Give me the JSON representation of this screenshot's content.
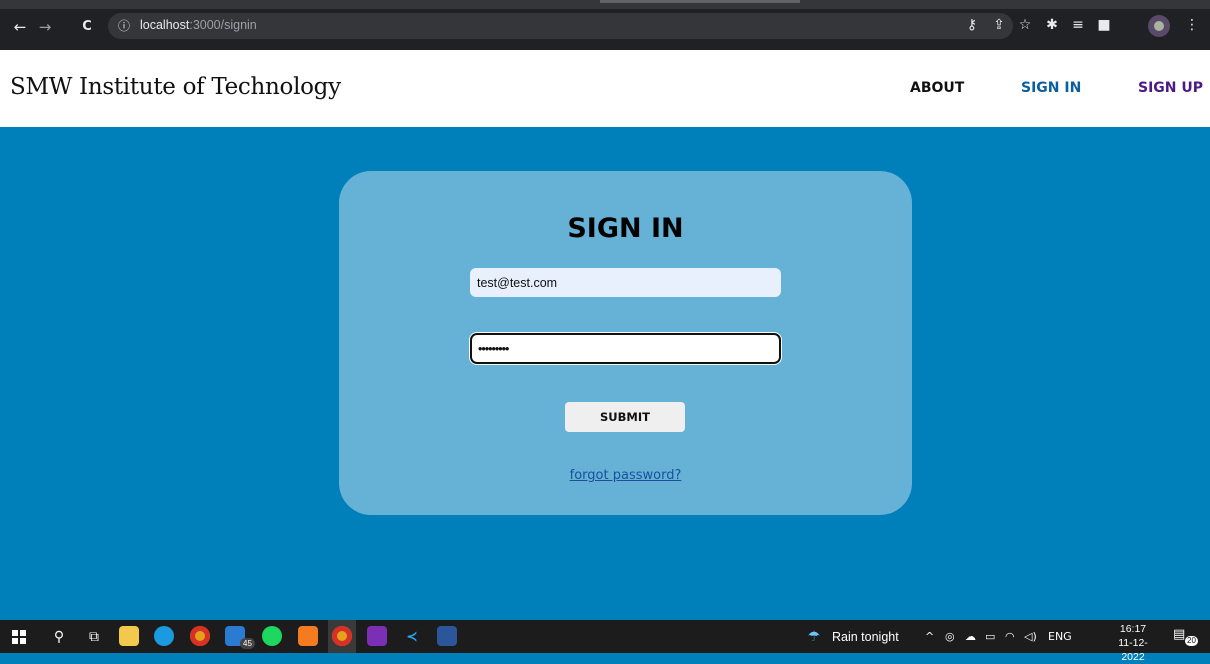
{
  "browser": {
    "back_glyph": "←",
    "forward_glyph": "→",
    "reload_glyph": "C",
    "url_host": "localhost",
    "url_rest": ":3000/signin",
    "info_glyph": "ⓘ",
    "icons": [
      "key-icon",
      "share-icon",
      "star-icon",
      "extensions-icon",
      "reading-list-icon",
      "side-panel-icon",
      "profile-icon",
      "menu-icon"
    ]
  },
  "header": {
    "brand": "SMW Institute of Technology",
    "nav": {
      "about": "ABOUT",
      "signin": "SIGN IN",
      "signup": "SIGN UP"
    }
  },
  "signin_form": {
    "title": "SIGN IN",
    "email_value": "test@test.com",
    "password_value": "•••••••••",
    "submit_label": "SUBMIT",
    "forgot_label": "forgot password?"
  },
  "colors": {
    "page_background": "#0080bb",
    "card_background": "#66b2d6",
    "signin_link": "#0b5fa0",
    "signup_link": "#4b1a86"
  },
  "taskbar": {
    "mail_badge": "45",
    "weather": "Rain tonight",
    "language": "ENG",
    "time": "16:17",
    "date": "11-12-2022",
    "notifications_count": "20"
  }
}
